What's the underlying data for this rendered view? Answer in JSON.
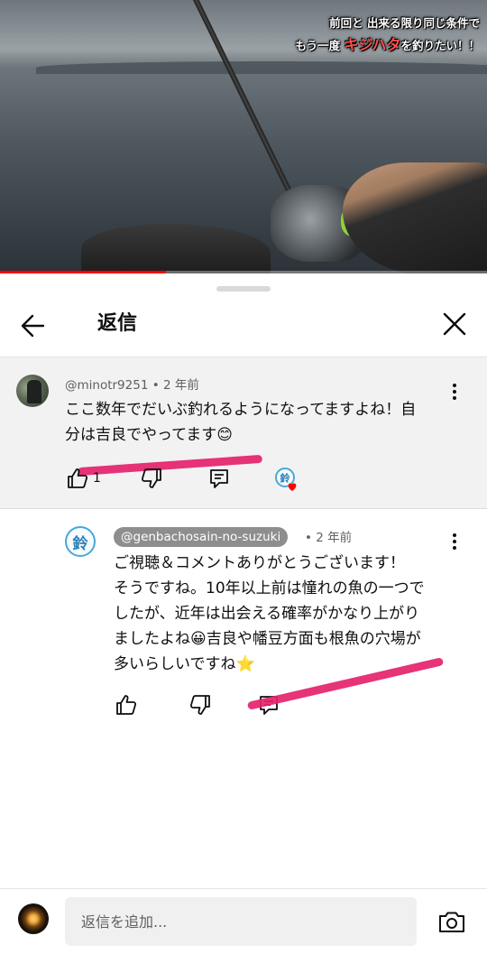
{
  "video": {
    "caption_line1": "前回と 出来る限り同じ条件で",
    "caption_line2_prefix": "もう一度",
    "caption_line2_accent": "キジハタ",
    "caption_line2_suffix": "を釣りたい！！",
    "caption_accent_color": "#ff4d4d",
    "progress_fraction": 0.34
  },
  "sheet": {
    "title": "返信",
    "back_icon": "arrow-left-icon",
    "close_icon": "close-icon"
  },
  "parent_comment": {
    "author": "@minotr9251",
    "time": "2 年前",
    "text_line1": "ここ数年でだいぶ釣れるようになってますよね！自",
    "text_line2": "分は吉良でやってます😊",
    "like_count": "1",
    "icons": [
      "thumb-up-icon",
      "thumb-down-icon",
      "reply-icon",
      "creator-heart-icon",
      "more-vert-icon"
    ]
  },
  "reply": {
    "author": "@genbachosain-no-suzuki",
    "time": "2 年前",
    "avatar_glyph": "鈴",
    "text_lines": [
      "ご視聴＆コメントありがとうございます！",
      "そうですね。10年以上前は憧れの魚の一つで",
      "したが、近年は出会える確率がかなり上がり",
      "ましたよね😀吉良や幡豆方面も根魚の穴場が",
      "多いらしいですね⭐"
    ],
    "icons": [
      "thumb-up-icon",
      "thumb-down-icon",
      "reply-icon",
      "more-vert-icon"
    ]
  },
  "composer": {
    "placeholder": "返信を追加...",
    "camera_icon": "camera-icon"
  },
  "colors": {
    "highlight": "#e5226b",
    "progress": "#ff0000",
    "heart": "#ff0000"
  }
}
